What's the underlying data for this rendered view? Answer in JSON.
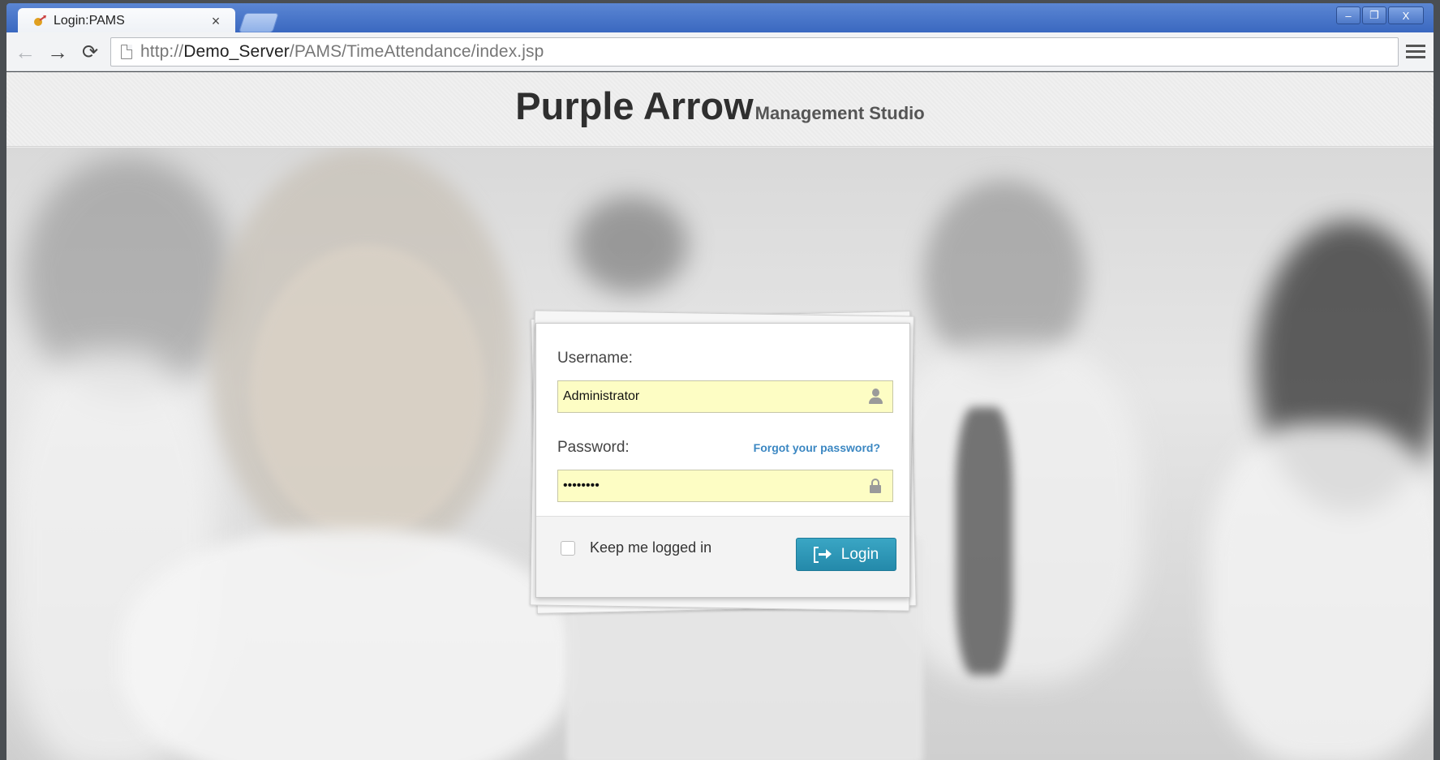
{
  "browser": {
    "tab_title": "Login:PAMS",
    "tab_close": "×",
    "url_scheme": "http://",
    "url_host": "Demo_Server",
    "url_path": "/PAMS/TimeAttendance/index.jsp",
    "controls": {
      "minimize": "–",
      "restore": "❐",
      "close": "X"
    },
    "nav": {
      "back": "←",
      "forward": "→",
      "reload": "⟳"
    }
  },
  "header": {
    "brand_main": "Purple Arrow",
    "brand_sub": "Management Studio"
  },
  "login": {
    "username_label": "Username:",
    "username_value": "Administrator",
    "password_label": "Password:",
    "password_value": "••••••••",
    "forgot_link": "Forgot your password?",
    "keep_logged_in_label": "Keep me logged in",
    "keep_logged_in_checked": false,
    "login_button": "Login"
  },
  "colors": {
    "titlebar": "#4a78c9",
    "input_bg": "#fdfdc4",
    "login_button": "#2e97b8",
    "link": "#3b87c2"
  }
}
